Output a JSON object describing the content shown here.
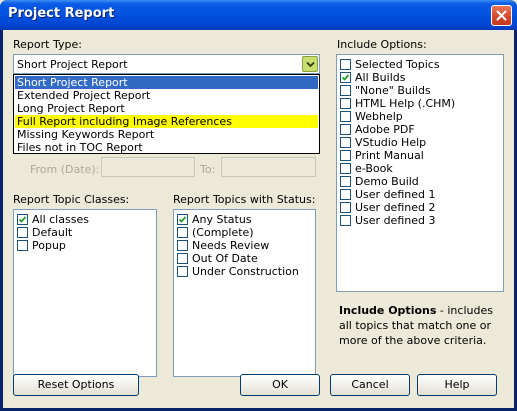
{
  "window": {
    "title": "Project Report"
  },
  "report_type": {
    "label": "Report Type:",
    "selected": "Short Project Report",
    "options": [
      "Short Project Report",
      "Extended Project Report",
      "Long Project Report",
      "Full Report including Image References",
      "Missing Keywords Report",
      "Files not in TOC Report"
    ]
  },
  "dates": {
    "from_label": "From (Date):",
    "to_label": "To:"
  },
  "topic_classes": {
    "label": "Report Topic Classes:",
    "items": [
      {
        "label": "All classes",
        "checked": true
      },
      {
        "label": "Default",
        "checked": false
      },
      {
        "label": "Popup",
        "checked": false
      }
    ]
  },
  "topic_status": {
    "label": "Report Topics with Status:",
    "items": [
      {
        "label": "Any Status",
        "checked": true
      },
      {
        "label": "(Complete)",
        "checked": false
      },
      {
        "label": "Needs Review",
        "checked": false
      },
      {
        "label": "Out Of Date",
        "checked": false
      },
      {
        "label": "Under Construction",
        "checked": false
      }
    ]
  },
  "include_options": {
    "label": "Include Options:",
    "items": [
      {
        "label": "Selected Topics",
        "checked": false
      },
      {
        "label": "All Builds",
        "checked": true
      },
      {
        "label": "\"None\" Builds",
        "checked": false
      },
      {
        "label": "HTML Help (.CHM)",
        "checked": false
      },
      {
        "label": "Webhelp",
        "checked": false
      },
      {
        "label": "Adobe PDF",
        "checked": false
      },
      {
        "label": "VStudio Help",
        "checked": false
      },
      {
        "label": "Print Manual",
        "checked": false
      },
      {
        "label": "e-Book",
        "checked": false
      },
      {
        "label": "Demo Build",
        "checked": false
      },
      {
        "label": "User defined 1",
        "checked": false
      },
      {
        "label": "User defined 2",
        "checked": false
      },
      {
        "label": "User defined 3",
        "checked": false
      }
    ],
    "info_bold": "Include Options",
    "info_rest": " - includes all topics that match one or more of the above criteria."
  },
  "buttons": {
    "reset": "Reset Options",
    "ok": "OK",
    "cancel": "Cancel",
    "help": "Help"
  },
  "colors": {
    "title_bar": "#0053e0",
    "selection": "#316ac5",
    "highlight": "#ffff00",
    "dialog_bg": "#ece9d8"
  }
}
